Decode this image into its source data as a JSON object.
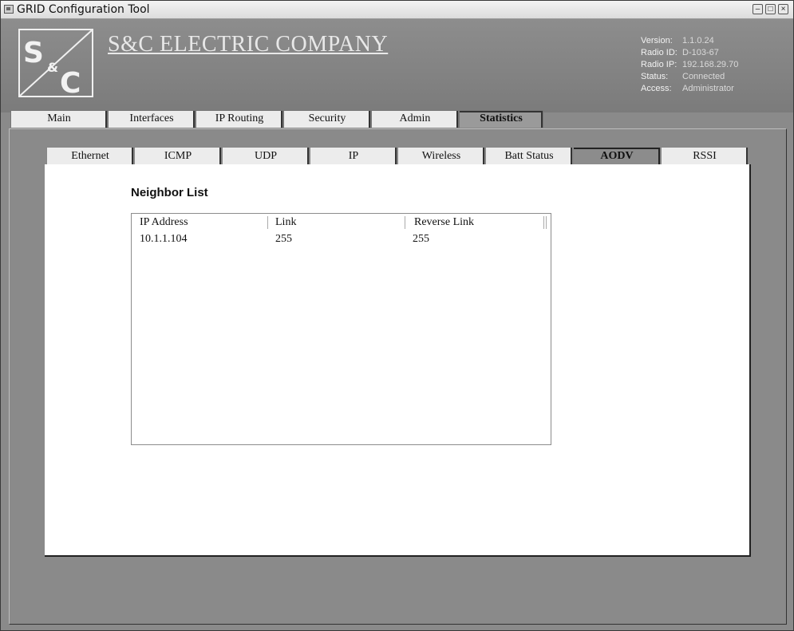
{
  "window": {
    "title": "GRID Configuration Tool"
  },
  "header": {
    "company": "S&C ELECTRIC COMPANY",
    "logo_text": "S&C",
    "info": [
      {
        "label": "Version:",
        "value": "1.1.0.24"
      },
      {
        "label": "Radio ID:",
        "value": "D-103-67"
      },
      {
        "label": "Radio IP:",
        "value": "192.168.29.70"
      },
      {
        "label": "Status:",
        "value": "Connected"
      },
      {
        "label": "Access:",
        "value": "Administrator"
      }
    ]
  },
  "main_tabs": [
    "Main",
    "Interfaces",
    "IP Routing",
    "Security",
    "Admin",
    "Statistics"
  ],
  "main_tab_active": "Statistics",
  "sub_tabs": [
    "Ethernet",
    "ICMP",
    "UDP",
    "IP",
    "Wireless",
    "Batt Status",
    "AODV",
    "RSSI"
  ],
  "sub_tab_active": "AODV",
  "panel": {
    "title": "Neighbor List",
    "columns": [
      "IP Address",
      "Link",
      "Reverse Link"
    ],
    "rows": [
      [
        "10.1.1.104",
        "255",
        "255"
      ]
    ]
  },
  "colors": {
    "frame_gray": "#8a8a8a",
    "tab_light": "#ececec",
    "tab_active": "#8c8c8c"
  }
}
